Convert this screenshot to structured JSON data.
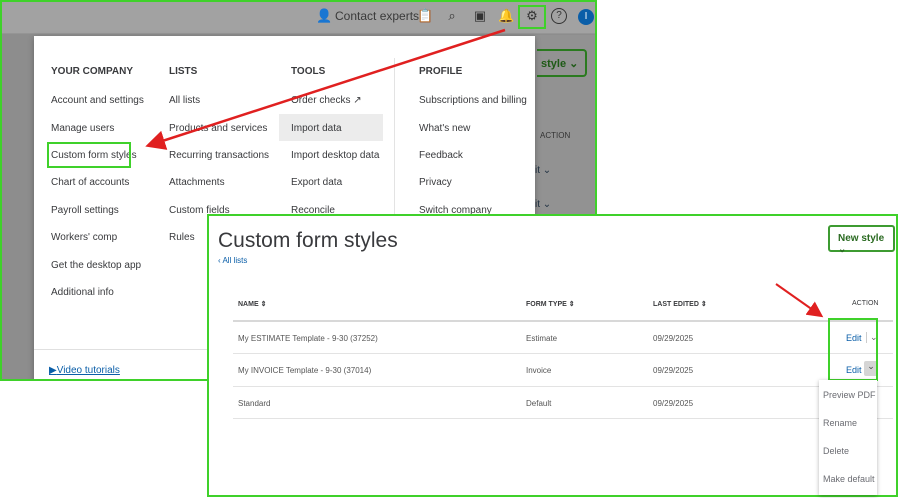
{
  "topbar": {
    "contact": "Contact experts",
    "avatar_initial": "I"
  },
  "background": {
    "new_style": "style",
    "action": "ACTION",
    "edit": "Edit"
  },
  "menu": {
    "your_company": {
      "heading": "YOUR COMPANY",
      "items": [
        "Account and settings",
        "Manage users",
        "Custom form styles",
        "Chart of accounts",
        "Payroll settings",
        "Workers' comp",
        "Get the desktop app",
        "Additional info"
      ]
    },
    "lists": {
      "heading": "LISTS",
      "items": [
        "All lists",
        "Products and services",
        "Recurring transactions",
        "Attachments",
        "Custom fields",
        "Rules"
      ]
    },
    "tools": {
      "heading": "TOOLS",
      "items": [
        "Order checks",
        "Import data",
        "Import desktop data",
        "Export data",
        "Reconcile"
      ]
    },
    "profile": {
      "heading": "PROFILE",
      "items": [
        "Subscriptions and billing",
        "What's new",
        "Feedback",
        "Privacy",
        "Switch company"
      ]
    },
    "video_tutorials": "Video tutorials"
  },
  "page": {
    "title": "Custom form styles",
    "back_link": "All lists",
    "new_style": "New style",
    "columns": [
      "NAME",
      "FORM TYPE",
      "LAST EDITED",
      "ACTION"
    ],
    "rows": [
      {
        "name": "My ESTIMATE Template - 9-30 (37252)",
        "type": "Estimate",
        "edited": "09/29/2025",
        "action": "Edit"
      },
      {
        "name": "My INVOICE Template - 9-30 (37014)",
        "type": "Invoice",
        "edited": "09/29/2025",
        "action": "Edit"
      },
      {
        "name": "Standard",
        "type": "Default",
        "edited": "09/29/2025",
        "action": ""
      }
    ],
    "dropdown": [
      "Preview PDF",
      "Rename",
      "Delete",
      "Make default"
    ]
  },
  "colors": {
    "highlight": "#3fd12a",
    "arrow": "#e02020",
    "link": "#0a5ea8"
  }
}
